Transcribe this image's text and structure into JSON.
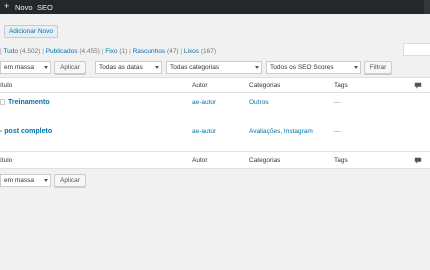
{
  "adminbar": {
    "new_label": "Novo",
    "seo_label": "SEO"
  },
  "add_new_label": "Adicionar Novo",
  "filters": [
    {
      "label": "Tudo",
      "count": "(4.502)"
    },
    {
      "label": "Publicados",
      "count": "(4.455)"
    },
    {
      "label": "Fixo",
      "count": "(1)"
    },
    {
      "label": "Rascunhos",
      "count": "(47)"
    },
    {
      "label": "Lixos",
      "count": "(167)"
    }
  ],
  "bulk_actions_top": "em massa",
  "bulk_actions_bottom": "em massa",
  "apply_label": "Aplicar",
  "dates_select": "Todas as datas",
  "categories_select": "Todas categorias",
  "seo_select": "Todos os SEO Scores",
  "filter_label": "Filtrar",
  "columns": {
    "title": "ítulo",
    "author": "Autor",
    "categories": "Categorias",
    "tags": "Tags"
  },
  "rows": [
    {
      "title": "Treinamento",
      "author": "ae-autor",
      "categories": "Outros",
      "tags": "—"
    },
    {
      "title": "- post completo",
      "author": "ae-autor",
      "categories": "Avaliações, Instagram",
      "tags": "—"
    }
  ]
}
